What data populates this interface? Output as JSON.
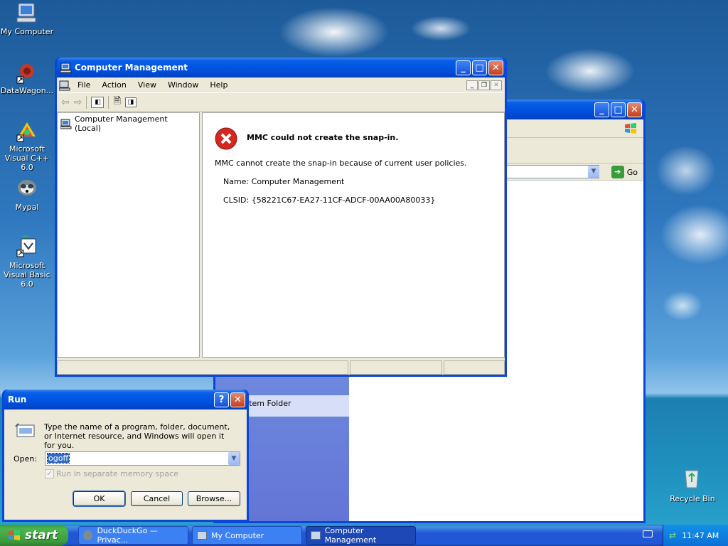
{
  "desktop": {
    "icons": [
      {
        "label": "My Computer",
        "icon": "my-computer-icon"
      },
      {
        "label": "DataWagon...",
        "icon": "datawagon-icon"
      },
      {
        "label": "Microsoft Visual C++ 6.0",
        "icon": "visual-cpp-icon"
      },
      {
        "label": "Mypal",
        "icon": "mypal-icon"
      },
      {
        "label": "Microsoft Visual Basic 6.0",
        "icon": "visual-basic-icon"
      },
      {
        "label": "Recycle Bin",
        "icon": "recycle-bin-icon"
      }
    ]
  },
  "mycomputer": {
    "go_label": "Go",
    "system_folder": "System Folder"
  },
  "mmc": {
    "title": "Computer Management",
    "menu": [
      "File",
      "Action",
      "View",
      "Window",
      "Help"
    ],
    "tree_item": "Computer Management (Local)",
    "error_title": "MMC could not create the snap-in.",
    "error_desc": "MMC cannot create the snap-in because of current user policies.",
    "name_line": "Name: Computer Management",
    "clsid_line": "CLSID: {58221C67-EA27-11CF-ADCF-00AA00A80033}"
  },
  "run": {
    "title": "Run",
    "description": "Type the name of a program, folder, document, or Internet resource, and Windows will open it for you.",
    "open_label": "Open:",
    "open_value": "ogoff",
    "separate_memory": "Run in separate memory space",
    "ok": "OK",
    "cancel": "Cancel",
    "browse": "Browse..."
  },
  "taskbar": {
    "start": "start",
    "tasks": [
      "DuckDuckGo — Privac...",
      "My Computer",
      "Computer Management"
    ],
    "clock": "11:47 AM"
  }
}
